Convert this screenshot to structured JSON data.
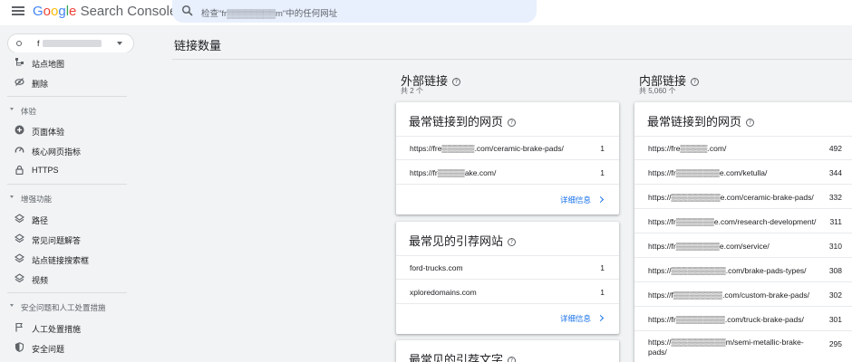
{
  "header": {
    "logo_google": "Google",
    "logo_product": "Search Console",
    "search_placeholder": "检查\"fr▒▒▒▒▒▒▒▒m\"中的任何网址",
    "property_name": "f"
  },
  "sidebar": {
    "items_top": [
      {
        "label": "站点地图",
        "icon": "sitemap-icon"
      },
      {
        "label": "删除",
        "icon": "eye-off-icon"
      }
    ],
    "sections": [
      {
        "title": "体验",
        "items": [
          {
            "label": "页面体验",
            "icon": "plus-circle-icon"
          },
          {
            "label": "核心网页指标",
            "icon": "speed-icon"
          },
          {
            "label": "HTTPS",
            "icon": "lock-icon"
          }
        ]
      },
      {
        "title": "增强功能",
        "items": [
          {
            "label": "路径",
            "icon": "layers-icon"
          },
          {
            "label": "常见问题解答",
            "icon": "layers-icon"
          },
          {
            "label": "站点链接搜索框",
            "icon": "layers-icon"
          },
          {
            "label": "视频",
            "icon": "layers-icon"
          }
        ]
      },
      {
        "title": "安全问题和人工处置措施",
        "items": [
          {
            "label": "人工处置措施",
            "icon": "flag-icon"
          },
          {
            "label": "安全问题",
            "icon": "shield-icon"
          }
        ]
      }
    ]
  },
  "main": {
    "page_title": "链接数量",
    "external": {
      "title": "外部链接",
      "subtitle": "共 2 个",
      "top_linked_pages": {
        "title": "最常链接到的网页",
        "rows": [
          {
            "url": "https://fre▒▒▒▒▒▒.com/ceramic-brake-pads/",
            "count": "1"
          },
          {
            "url": "https://fr▒▒▒▒▒ake.com/",
            "count": "1"
          }
        ],
        "more": "详细信息"
      },
      "top_linking_sites": {
        "title": "最常见的引荐网站",
        "rows": [
          {
            "url": "ford-trucks.com",
            "count": "1"
          },
          {
            "url": "xploredomains.com",
            "count": "1"
          }
        ],
        "more": "详细信息"
      },
      "top_linking_text": {
        "title": "最常见的引荐文字"
      }
    },
    "internal": {
      "title": "内部链接",
      "subtitle": "共 5,060 个",
      "top_linked_pages": {
        "title": "最常链接到的网页",
        "rows": [
          {
            "url": "https://fre▒▒▒▒▒.com/",
            "count": "492"
          },
          {
            "url": "https://fr▒▒▒▒▒▒▒▒e.com/ketulla/",
            "count": "344"
          },
          {
            "url": "https://▒▒▒▒▒▒▒▒▒e.com/ceramic-brake-pads/",
            "count": "332"
          },
          {
            "url": "https://fr▒▒▒▒▒▒▒e.com/research-development/",
            "count": "311"
          },
          {
            "url": "https://fr▒▒▒▒▒▒▒▒e.com/service/",
            "count": "310"
          },
          {
            "url": "https://▒▒▒▒▒▒▒▒▒▒.com/brake-pads-types/",
            "count": "308"
          },
          {
            "url": "https://f▒▒▒▒▒▒▒▒▒.com/custom-brake-pads/",
            "count": "302"
          },
          {
            "url": "https://fr▒▒▒▒▒▒▒▒▒.com/truck-brake-pads/",
            "count": "301"
          },
          {
            "url": "https://▒▒▒▒▒▒▒▒▒▒m/semi-metallic-brake-pads/",
            "count": "295"
          }
        ]
      }
    }
  }
}
